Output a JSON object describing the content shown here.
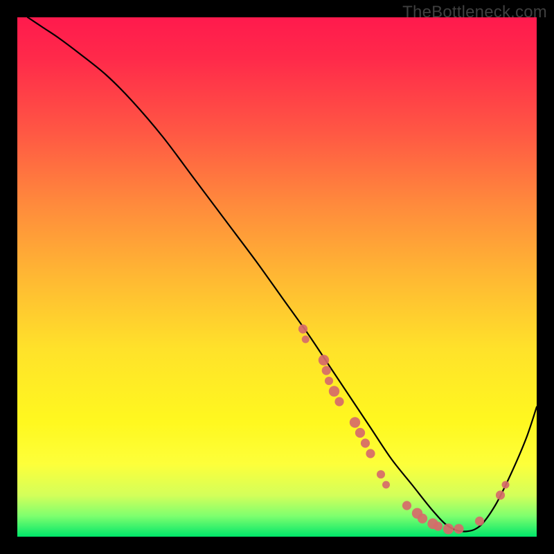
{
  "watermark": "TheBottleneck.com",
  "colors": {
    "dot": "#d66a6a",
    "curve": "#000000"
  },
  "chart_data": {
    "type": "line",
    "title": "",
    "xlabel": "",
    "ylabel": "",
    "xlim": [
      0,
      100
    ],
    "ylim": [
      0,
      100
    ],
    "x": [
      2,
      5,
      8,
      12,
      17,
      22,
      28,
      34,
      40,
      46,
      51,
      56,
      60,
      64,
      68,
      72,
      76,
      80,
      83,
      86,
      89,
      92,
      95,
      98,
      100
    ],
    "values": [
      100,
      98,
      96,
      93,
      89,
      84,
      77,
      69,
      61,
      53,
      46,
      39,
      33,
      27,
      21,
      15,
      10,
      5,
      2,
      1,
      2,
      6,
      12,
      19,
      25
    ],
    "scatter_points": [
      {
        "x": 55,
        "y": 40,
        "r": 1.2
      },
      {
        "x": 55.5,
        "y": 38,
        "r": 1.0
      },
      {
        "x": 59,
        "y": 34,
        "r": 1.4
      },
      {
        "x": 59.5,
        "y": 32,
        "r": 1.2
      },
      {
        "x": 60,
        "y": 30,
        "r": 1.1
      },
      {
        "x": 61,
        "y": 28,
        "r": 1.4
      },
      {
        "x": 62,
        "y": 26,
        "r": 1.2
      },
      {
        "x": 65,
        "y": 22,
        "r": 1.4
      },
      {
        "x": 66,
        "y": 20,
        "r": 1.3
      },
      {
        "x": 67,
        "y": 18,
        "r": 1.2
      },
      {
        "x": 68,
        "y": 16,
        "r": 1.2
      },
      {
        "x": 70,
        "y": 12,
        "r": 1.1
      },
      {
        "x": 71,
        "y": 10,
        "r": 1.0
      },
      {
        "x": 75,
        "y": 6,
        "r": 1.2
      },
      {
        "x": 77,
        "y": 4.5,
        "r": 1.4
      },
      {
        "x": 78,
        "y": 3.5,
        "r": 1.3
      },
      {
        "x": 80,
        "y": 2.5,
        "r": 1.4
      },
      {
        "x": 81,
        "y": 2,
        "r": 1.2
      },
      {
        "x": 83,
        "y": 1.5,
        "r": 1.4
      },
      {
        "x": 85,
        "y": 1.5,
        "r": 1.3
      },
      {
        "x": 89,
        "y": 3,
        "r": 1.2
      },
      {
        "x": 93,
        "y": 8,
        "r": 1.2
      },
      {
        "x": 94,
        "y": 10,
        "r": 1.0
      }
    ]
  }
}
